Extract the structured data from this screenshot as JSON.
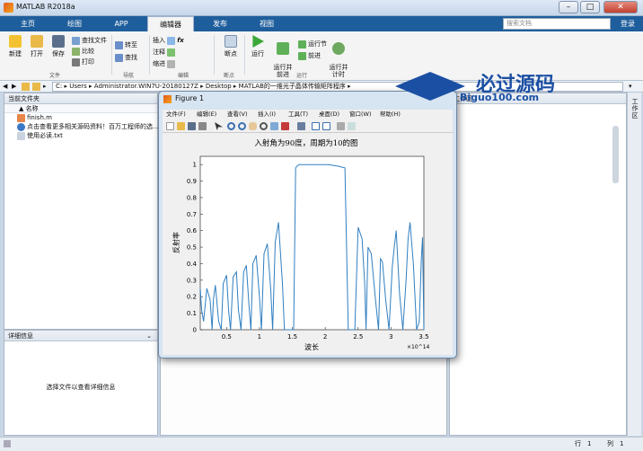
{
  "window": {
    "title": "MATLAB R2018a"
  },
  "tabs": [
    {
      "label": "主页"
    },
    {
      "label": "绘图"
    },
    {
      "label": "APP"
    },
    {
      "label": "编辑器"
    },
    {
      "label": "发布"
    },
    {
      "label": "视图"
    }
  ],
  "search": {
    "placeholder": "搜索文档"
  },
  "login_label": "登录",
  "ribbon": {
    "new": "新建",
    "open": "打开",
    "save": "保存",
    "find_file": "查找文件",
    "compare": "比较",
    "print": "打印",
    "goto": "转至",
    "find": "查找",
    "insert": "插入",
    "comment": "注释",
    "indent": "缩进",
    "breakpoint": "断点",
    "run": "运行",
    "run_advance": "运行并\n前进",
    "run_section": "运行节",
    "advance": "前进",
    "run_time": "运行并\n计时",
    "groups": {
      "file": "文件",
      "nav": "导航",
      "edit": "编辑",
      "bp": "断点",
      "run": "运行"
    }
  },
  "address": {
    "path": [
      "C:",
      "Users",
      "Administrator.WIN7U-20180127Z",
      "Desktop",
      "MATLAB的一维光子晶体传输矩阵程序"
    ]
  },
  "file_panel": {
    "title": "当前文件夹",
    "column": "名称",
    "sort_mark": "▲",
    "files": [
      {
        "name": "finish.m",
        "icon": "m-file-icon"
      },
      {
        "name": "点击查看更多相关源码资料！百万工程师的选...",
        "icon": "link-icon"
      },
      {
        "name": "使用必读.txt",
        "icon": "text-file-icon"
      }
    ]
  },
  "detail_panel": {
    "title": "详细信息",
    "empty_text": "选择文件以查看详细信息"
  },
  "workspace_panel": {
    "title": "工作区",
    "side_label": "工作区"
  },
  "figure": {
    "title": "Figure 1",
    "menu": [
      "文件(F)",
      "编辑(E)",
      "查看(V)",
      "插入(I)",
      "工具(T)",
      "桌面(D)",
      "窗口(W)",
      "帮助(H)"
    ]
  },
  "status": {
    "row_label": "行",
    "row_value": "1",
    "col_label": "列",
    "col_value": "1"
  },
  "watermark": {
    "line1": "必过源码",
    "line2": "Biguo100.com"
  },
  "chart_data": {
    "type": "line",
    "title": "入射角为90度，周期为10的图",
    "xlabel": "波长",
    "ylabel": "反射率",
    "x_multiplier": "×10^14",
    "xlim": [
      0.1,
      3.5
    ],
    "ylim": [
      0,
      1.05
    ],
    "xticks": [
      "0.5",
      "1",
      "1.5",
      "2",
      "2.5",
      "3",
      "3.5"
    ],
    "yticks": [
      "0",
      "0.1",
      "0.2",
      "0.3",
      "0.4",
      "0.5",
      "0.6",
      "0.7",
      "0.8",
      "0.9",
      "1"
    ],
    "color": "#2f7fc1",
    "series": [
      {
        "x": [
          0.1,
          0.12,
          0.15,
          0.2,
          0.25,
          0.28,
          0.3,
          0.33,
          0.38,
          0.42,
          0.45,
          0.5,
          0.53,
          0.56,
          0.6,
          0.65,
          0.68,
          0.72,
          0.76,
          0.8,
          0.84,
          0.87,
          0.9,
          0.95,
          1.0,
          1.03,
          1.07,
          1.12,
          1.17,
          1.2,
          1.24,
          1.29,
          1.35,
          1.38,
          1.42,
          1.46,
          1.5,
          1.52,
          1.55,
          1.57,
          1.6,
          1.65,
          1.75,
          1.9,
          2.05,
          2.2,
          2.3,
          2.35,
          2.37,
          2.4,
          2.42,
          2.45,
          2.5,
          2.56,
          2.6,
          2.62,
          2.65,
          2.7,
          2.76,
          2.81,
          2.84,
          2.87,
          2.92,
          2.97,
          3.02,
          3.05,
          3.08,
          3.13,
          3.18,
          3.23,
          3.26,
          3.29,
          3.34,
          3.39,
          3.43,
          3.46,
          3.48,
          3.5
        ],
        "y": [
          0.25,
          0.12,
          0.05,
          0.25,
          0.18,
          0.0,
          0.18,
          0.27,
          0.05,
          0.0,
          0.28,
          0.33,
          0.12,
          0.0,
          0.32,
          0.35,
          0.12,
          0.0,
          0.35,
          0.39,
          0.15,
          0.0,
          0.4,
          0.45,
          0.2,
          0.0,
          0.46,
          0.52,
          0.25,
          0.0,
          0.53,
          0.65,
          0.28,
          0.0,
          0.0,
          0.0,
          0.0,
          0.0,
          0.98,
          0.99,
          1.0,
          1.0,
          1.0,
          1.0,
          1.0,
          0.99,
          0.98,
          0.0,
          0.0,
          0.0,
          0.0,
          0.0,
          0.62,
          0.55,
          0.28,
          0.0,
          0.5,
          0.46,
          0.2,
          0.0,
          0.43,
          0.41,
          0.18,
          0.0,
          0.38,
          0.5,
          0.6,
          0.22,
          0.0,
          0.3,
          0.55,
          0.65,
          0.4,
          0.0,
          0.05,
          0.42,
          0.56,
          0.0
        ]
      }
    ]
  }
}
